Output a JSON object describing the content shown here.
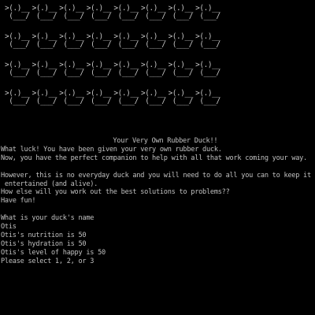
{
  "console": {
    "foreground": "#c0c0c0",
    "background": "#000000"
  },
  "ascii_duck": {
    "line1": ">(.)__",
    "line2": " (___/"
  },
  "duck_grid": {
    "rows": 4,
    "columns": 8
  },
  "heading": "Your Very Own Rubber Duck!!",
  "intro_lines": [
    "What luck! You have been given your very own rubber duck.",
    "Now, you have the perfect companion to help with all that work coming your way."
  ],
  "warning_lines": [
    "However, this is no everyday duck and you will need to do all you can to keep it",
    " entertained (and alive).",
    "How else will you work out the best solutions to problems??",
    "Have fun!"
  ],
  "prompt_lines": [
    "What is your duck's name",
    "Otis",
    "Otis's nutrition is 50",
    "Otis's hydration is 50",
    "Otis's level of happy is 50",
    "Please select 1, 2, or 3"
  ]
}
